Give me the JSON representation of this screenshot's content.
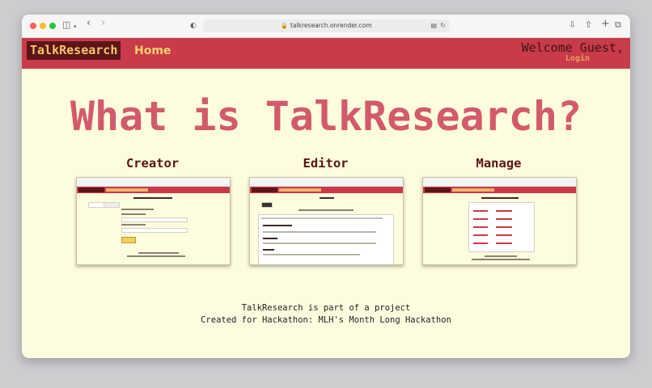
{
  "browser": {
    "url": "talkresearch.onrender.com"
  },
  "navbar": {
    "brand": "TalkResearch",
    "home": "Home",
    "welcome": "Welcome Guest,",
    "login": "Login"
  },
  "hero": {
    "title": "What is TalkResearch?"
  },
  "cards": [
    {
      "title": "Creator"
    },
    {
      "title": "Editor"
    },
    {
      "title": "Manage"
    }
  ],
  "footer": {
    "line1": "TalkResearch is part of a project",
    "line2": "Created for Hackathon: MLH's Month Long Hackathon"
  },
  "colors": {
    "navbar": "#c93a4a",
    "brand_bg": "#5d1518",
    "page_bg": "#fefcdf",
    "hero": "#d25a6b"
  }
}
